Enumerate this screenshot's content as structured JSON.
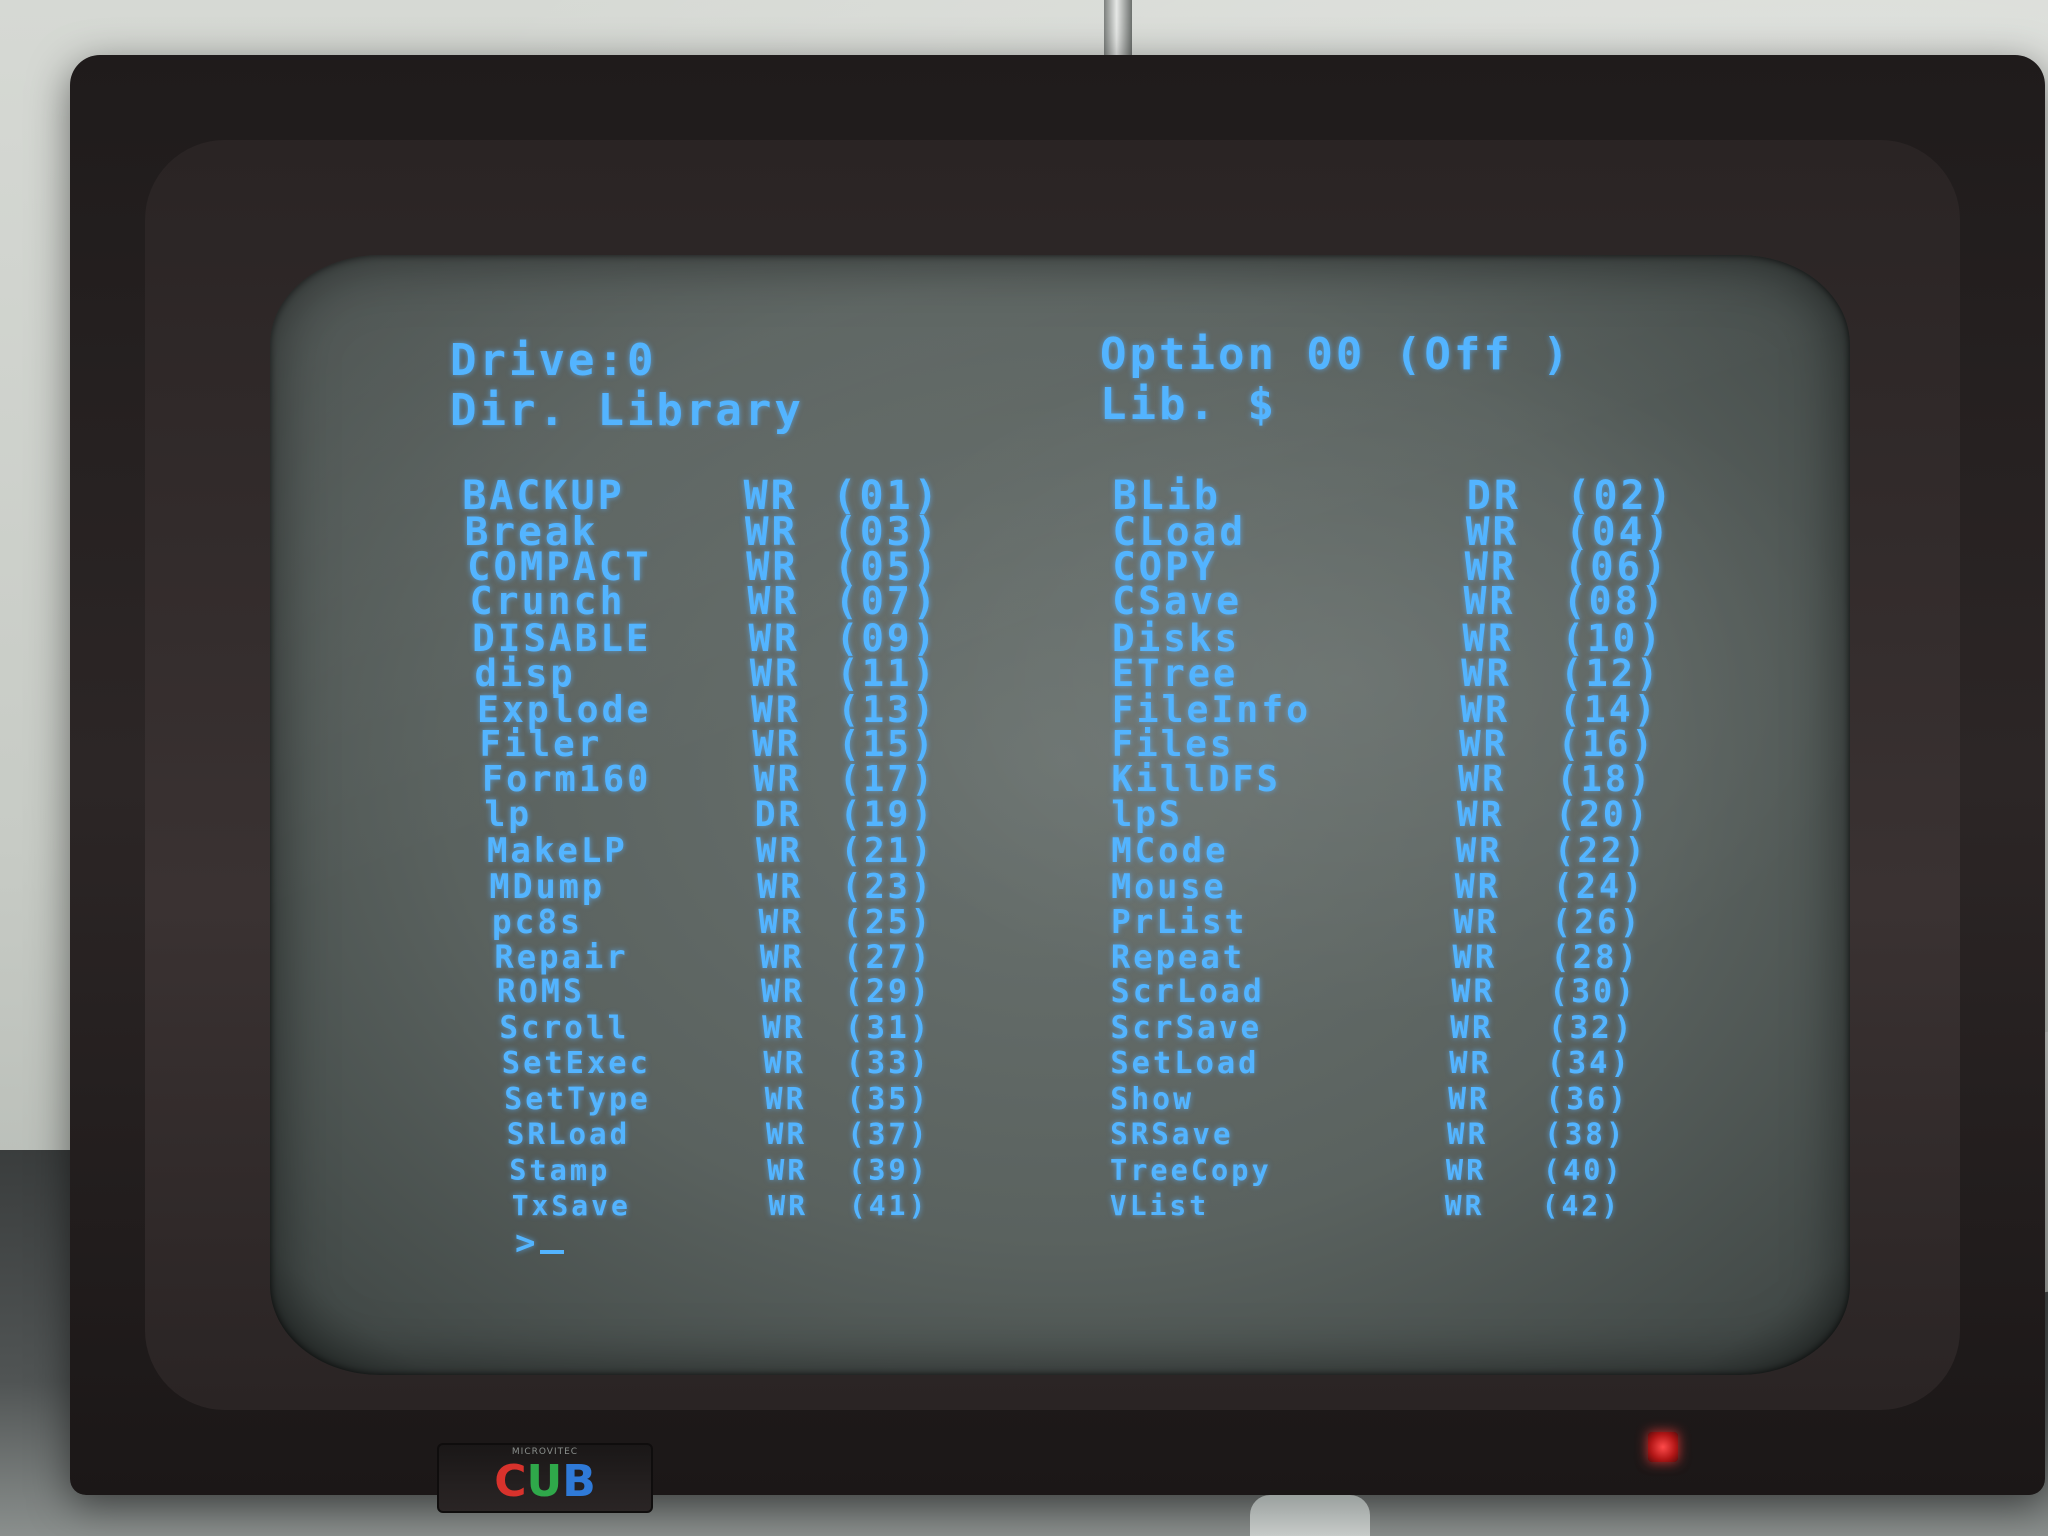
{
  "screen": {
    "drive_label": "Drive:0",
    "option_label": "Option 00 (Off )",
    "dir_label": "Dir. Library",
    "lib_label": "Lib. $",
    "prompt": ">"
  },
  "files": [
    {
      "name": "BACKUP",
      "attr": "WR",
      "num": "(01)"
    },
    {
      "name": "BLib",
      "attr": "DR",
      "num": "(02)"
    },
    {
      "name": "Break",
      "attr": "WR",
      "num": "(03)"
    },
    {
      "name": "CLoad",
      "attr": "WR",
      "num": "(04)"
    },
    {
      "name": "COMPACT",
      "attr": "WR",
      "num": "(05)"
    },
    {
      "name": "COPY",
      "attr": "WR",
      "num": "(06)"
    },
    {
      "name": "Crunch",
      "attr": "WR",
      "num": "(07)"
    },
    {
      "name": "CSave",
      "attr": "WR",
      "num": "(08)"
    },
    {
      "name": "DISABLE",
      "attr": "WR",
      "num": "(09)"
    },
    {
      "name": "Disks",
      "attr": "WR",
      "num": "(10)"
    },
    {
      "name": "disp",
      "attr": "WR",
      "num": "(11)"
    },
    {
      "name": "ETree",
      "attr": "WR",
      "num": "(12)"
    },
    {
      "name": "Explode",
      "attr": "WR",
      "num": "(13)"
    },
    {
      "name": "FileInfo",
      "attr": "WR",
      "num": "(14)"
    },
    {
      "name": "Filer",
      "attr": "WR",
      "num": "(15)"
    },
    {
      "name": "Files",
      "attr": "WR",
      "num": "(16)"
    },
    {
      "name": "Form160",
      "attr": "WR",
      "num": "(17)"
    },
    {
      "name": "KillDFS",
      "attr": "WR",
      "num": "(18)"
    },
    {
      "name": "lp",
      "attr": "DR",
      "num": "(19)"
    },
    {
      "name": "lpS",
      "attr": "WR",
      "num": "(20)"
    },
    {
      "name": "MakeLP",
      "attr": "WR",
      "num": "(21)"
    },
    {
      "name": "MCode",
      "attr": "WR",
      "num": "(22)"
    },
    {
      "name": "MDump",
      "attr": "WR",
      "num": "(23)"
    },
    {
      "name": "Mouse",
      "attr": "WR",
      "num": "(24)"
    },
    {
      "name": "pc8s",
      "attr": "WR",
      "num": "(25)"
    },
    {
      "name": "PrList",
      "attr": "WR",
      "num": "(26)"
    },
    {
      "name": "Repair",
      "attr": "WR",
      "num": "(27)"
    },
    {
      "name": "Repeat",
      "attr": "WR",
      "num": "(28)"
    },
    {
      "name": "ROMS",
      "attr": "WR",
      "num": "(29)"
    },
    {
      "name": "ScrLoad",
      "attr": "WR",
      "num": "(30)"
    },
    {
      "name": "Scroll",
      "attr": "WR",
      "num": "(31)"
    },
    {
      "name": "ScrSave",
      "attr": "WR",
      "num": "(32)"
    },
    {
      "name": "SetExec",
      "attr": "WR",
      "num": "(33)"
    },
    {
      "name": "SetLoad",
      "attr": "WR",
      "num": "(34)"
    },
    {
      "name": "SetType",
      "attr": "WR",
      "num": "(35)"
    },
    {
      "name": "Show",
      "attr": "WR",
      "num": "(36)"
    },
    {
      "name": "SRLoad",
      "attr": "WR",
      "num": "(37)"
    },
    {
      "name": "SRSave",
      "attr": "WR",
      "num": "(38)"
    },
    {
      "name": "Stamp",
      "attr": "WR",
      "num": "(39)"
    },
    {
      "name": "TreeCopy",
      "attr": "WR",
      "num": "(40)"
    },
    {
      "name": "TxSave",
      "attr": "WR",
      "num": "(41)"
    },
    {
      "name": "VList",
      "attr": "WR",
      "num": "(42)"
    }
  ],
  "monitor": {
    "brand_logo": "CUB",
    "brand_small": "MICROVITEC",
    "text_color": "#53b4ff",
    "power_led_color": "#ff3030"
  }
}
